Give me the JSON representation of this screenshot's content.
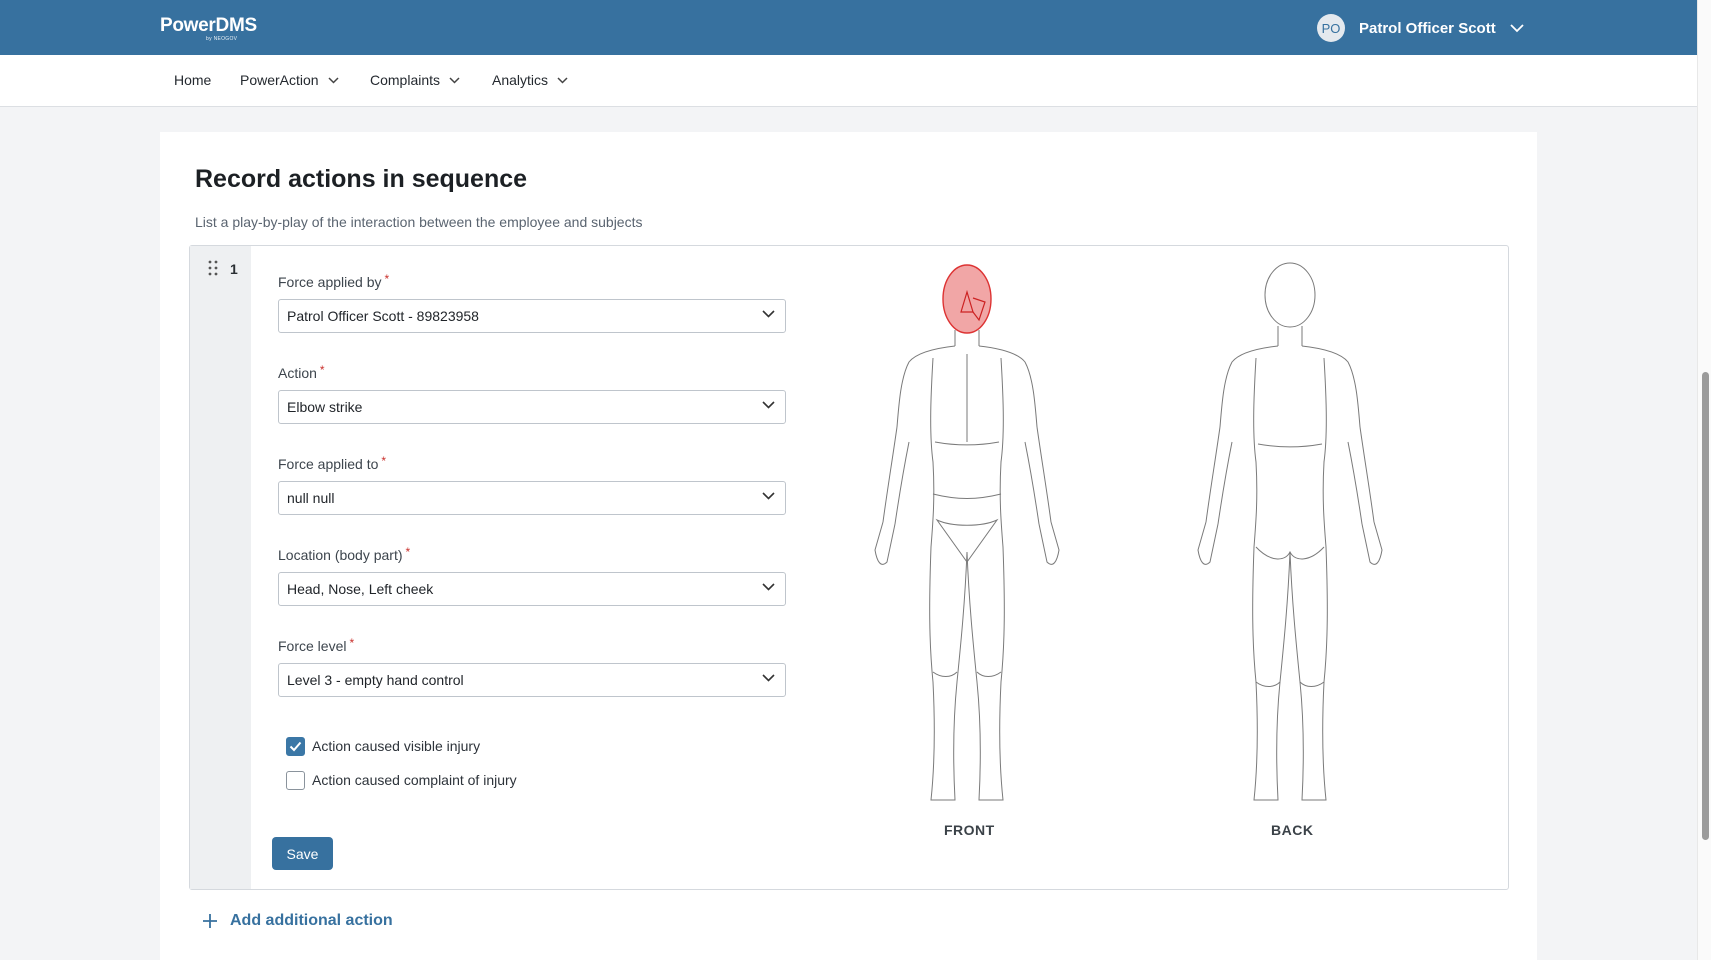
{
  "header": {
    "logo_text": "PowerDMS",
    "logo_sub": "by NEOGOV",
    "user_initials": "PO",
    "user_name": "Patrol Officer Scott"
  },
  "nav": {
    "home": "Home",
    "poweraction": "PowerAction",
    "complaints": "Complaints",
    "analytics": "Analytics"
  },
  "section": {
    "title": "Record actions in sequence",
    "subtitle": "List a play-by-play of the interaction between the employee and subjects"
  },
  "action": {
    "number": "1",
    "fields": [
      {
        "label": "Force applied by",
        "value": "Patrol Officer Scott - 89823958"
      },
      {
        "label": "Action",
        "value": "Elbow strike"
      },
      {
        "label": "Force applied to",
        "value": "null null"
      },
      {
        "label": "Location (body part)",
        "value": "Head, Nose, Left cheek"
      },
      {
        "label": "Force level",
        "value": "Level 3 - empty hand control"
      }
    ],
    "required_mark": "*",
    "checkboxes": [
      {
        "label": "Action caused visible injury",
        "checked": true
      },
      {
        "label": "Action caused complaint of injury",
        "checked": false
      }
    ],
    "save_label": "Save",
    "body_front_label": "FRONT",
    "body_back_label": "BACK",
    "highlighted_regions": [
      "Head",
      "Nose",
      "Left cheek"
    ]
  },
  "add_action_label": "Add additional action",
  "colors": {
    "brand": "#37719f",
    "highlight": "#e24b4b",
    "required": "#c9302c"
  }
}
